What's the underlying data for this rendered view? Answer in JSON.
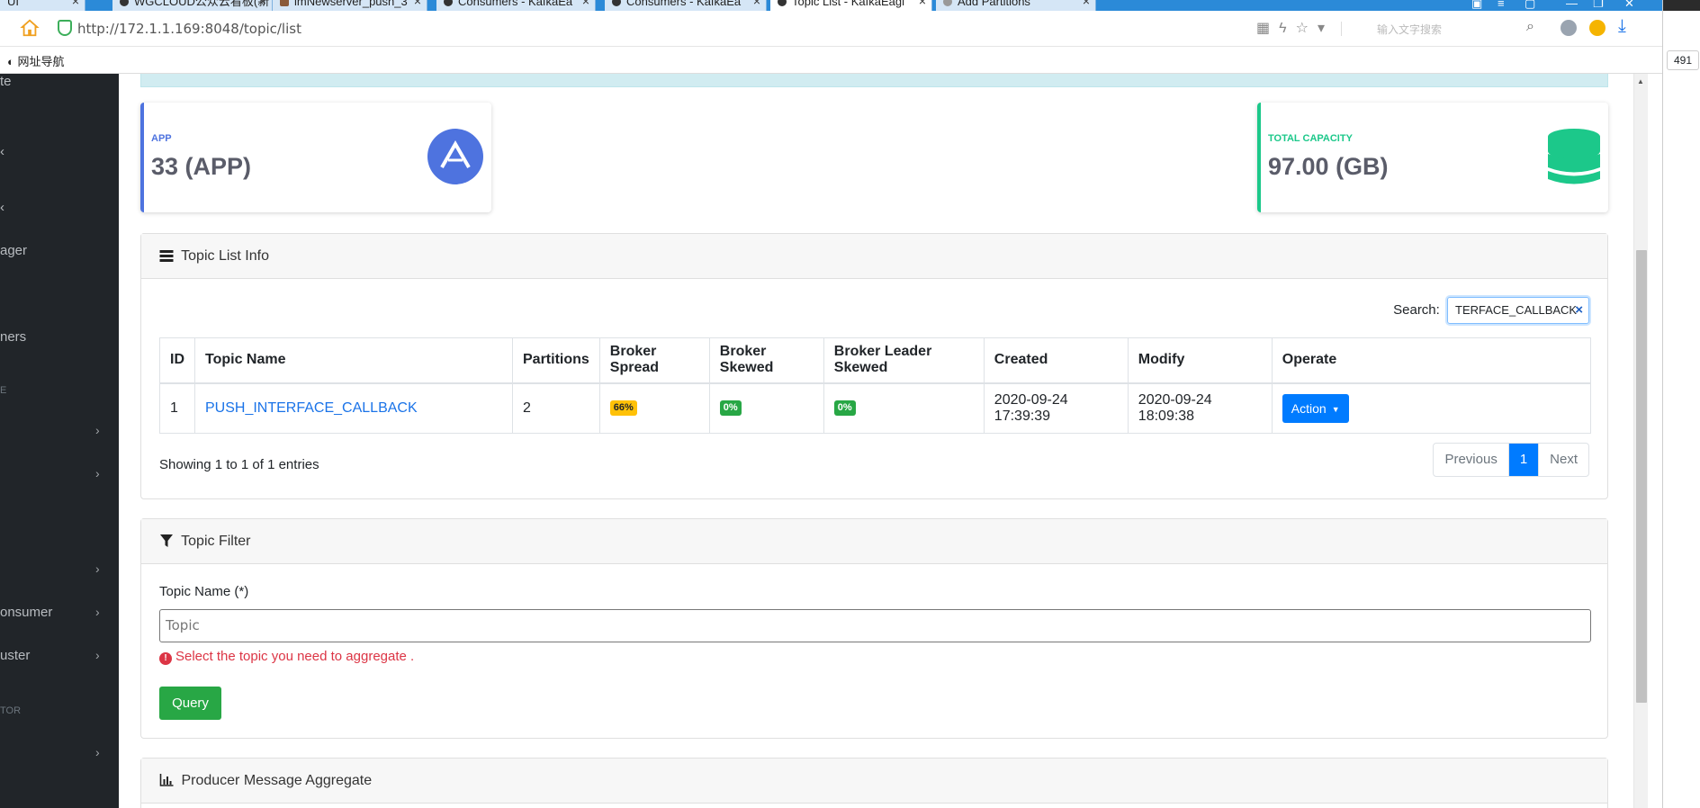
{
  "browser": {
    "tabs": [
      {
        "label": "UI"
      },
      {
        "label": "WGCLOUD公众云看板(新"
      },
      {
        "label": "imNewserver_push_3"
      },
      {
        "label": "Consumers - KafkaEa"
      },
      {
        "label": "Consumers - KafkaEa"
      },
      {
        "label": "Topic List - KafkaEagl"
      },
      {
        "label": "Add Partitions"
      }
    ],
    "url": "http://172.1.1.169:8048/topic/list",
    "search_placeholder": "输入文字搜索",
    "bookmark_label": "网址导航",
    "side_badge": "491"
  },
  "sidebar": {
    "items": [
      {
        "label": "te"
      },
      {
        "label": "ager"
      },
      {
        "label": "ners"
      },
      {
        "label": "onsumer"
      },
      {
        "label": "uster"
      }
    ],
    "headings": [
      {
        "label": "E"
      },
      {
        "label": "TOR"
      }
    ]
  },
  "stats": {
    "app": {
      "label": "APP",
      "value": "33 (APP)",
      "color": "#4e73df"
    },
    "capacity": {
      "label": "TOTAL CAPACITY",
      "value": "97.00 (GB)",
      "color": "#1cc88a"
    }
  },
  "topic_list": {
    "title": "Topic List Info",
    "search_label": "Search:",
    "search_value": "TERFACE_CALLBACK",
    "columns": [
      "ID",
      "Topic Name",
      "Partitions",
      "Broker Spread",
      "Broker Skewed",
      "Broker Leader Skewed",
      "Created",
      "Modify",
      "Operate"
    ],
    "rows": [
      {
        "id": "1",
        "name": "PUSH_INTERFACE_CALLBACK",
        "partitions": "2",
        "broker_spread": "66%",
        "broker_skewed": "0%",
        "broker_leader_skewed": "0%",
        "created": "2020-09-24 17:39:39",
        "modify": "2020-09-24 18:09:38",
        "action": "Action"
      }
    ],
    "showing": "Showing 1 to 1 of 1 entries",
    "pager": {
      "previous": "Previous",
      "current": "1",
      "next": "Next"
    }
  },
  "topic_filter": {
    "title": "Topic Filter",
    "field_label": "Topic Name (*)",
    "placeholder": "Topic",
    "error": "Select the topic you need to aggregate .",
    "button": "Query"
  },
  "producer_panel": {
    "title": "Producer Message Aggregate"
  }
}
